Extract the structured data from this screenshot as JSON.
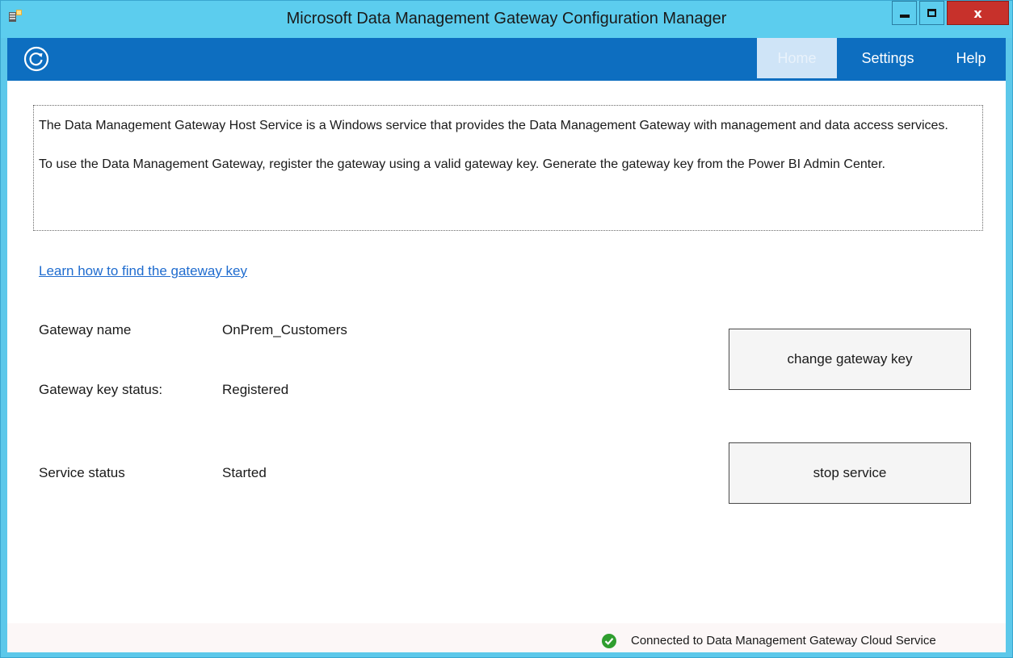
{
  "window": {
    "title": "Microsoft Data Management Gateway Configuration Manager",
    "icons": {
      "app": "gateway-app-icon",
      "minimize": "minimize-icon",
      "maximize": "maximize-icon",
      "close": "close-icon"
    },
    "close_glyph": "x"
  },
  "nav": {
    "refresh_icon": "refresh-icon",
    "items": [
      {
        "label": "Home",
        "active": true
      },
      {
        "label": "Settings",
        "active": false
      },
      {
        "label": "Help",
        "active": false
      }
    ],
    "colors": {
      "bar": "#0d6ec0",
      "active_tab": "#cfe4f7"
    }
  },
  "main": {
    "description": [
      "The Data Management Gateway Host Service is a Windows service that provides the Data Management Gateway with management and data access services.",
      "To use the Data Management Gateway, register the gateway using a valid gateway key. Generate the gateway key from the Power BI Admin Center."
    ],
    "learn_link": "Learn how to find the gateway key",
    "fields": {
      "gateway_name_label": "Gateway name",
      "gateway_name_value": "OnPrem_Customers",
      "key_status_label": "Gateway key status:",
      "key_status_value": "Registered",
      "service_status_label": "Service status",
      "service_status_value": "Started"
    },
    "buttons": {
      "change_key": "change gateway key",
      "stop_service": "stop service"
    }
  },
  "status": {
    "icon": "check-circle-icon",
    "text": "Connected to Data Management Gateway Cloud Service",
    "color": "#2f9e2f"
  }
}
